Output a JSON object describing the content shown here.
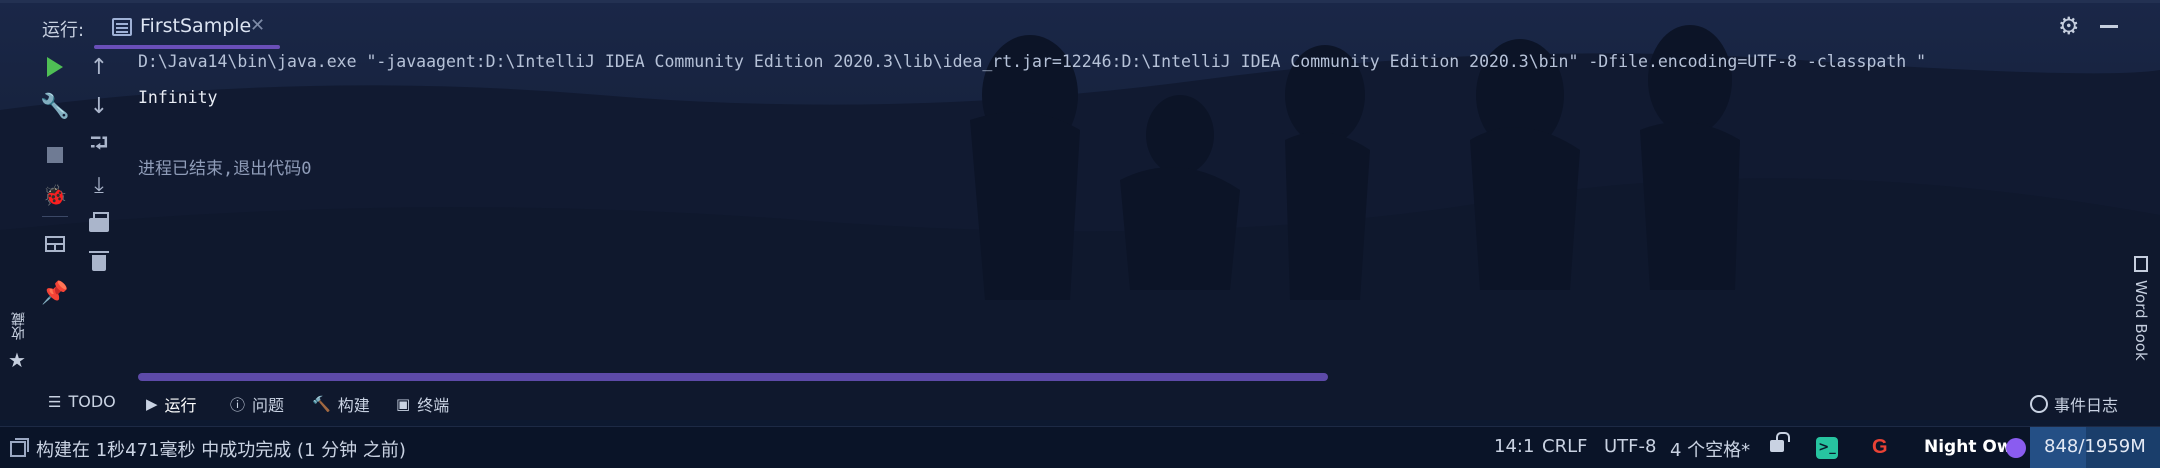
{
  "header": {
    "run_label": "运行:",
    "tab_title": "FirstSample"
  },
  "console": {
    "command_line": "D:\\Java14\\bin\\java.exe \"-javaagent:D:\\IntelliJ IDEA Community Edition 2020.3\\lib\\idea_rt.jar=12246:D:\\IntelliJ IDEA Community Edition 2020.3\\bin\" -Dfile.encoding=UTF-8 -classpath \"",
    "output": "Infinity",
    "exit_message": "进程已结束,退出代码0"
  },
  "left_toolbar": {
    "icons": [
      "run-icon",
      "wrench-icon",
      "stop-icon",
      "debug-icon",
      "layout-icon",
      "pin-icon"
    ]
  },
  "side_toolbar": {
    "icons": [
      "arrow-up-icon",
      "arrow-down-icon",
      "soft-wrap-icon",
      "scroll-to-end-icon",
      "print-icon",
      "trash-icon"
    ]
  },
  "favorites": {
    "label": "收藏"
  },
  "word_book": {
    "label": "Word Book"
  },
  "tool_windows": {
    "todo": "TODO",
    "run": "运行",
    "problems": "问题",
    "build": "构建",
    "terminal": "终端",
    "event_log": "事件日志"
  },
  "status_bar": {
    "message": "构建在 1秒471毫秒 中成功完成 (1 分钟 之前)",
    "position": "14:1",
    "line_separator": "CRLF",
    "encoding": "UTF-8",
    "indent": "4 个空格*",
    "theme": "Night Owl",
    "memory": "848/1959M",
    "memory_used_fraction": 0.43
  },
  "colors": {
    "run_green": "#4fbf55",
    "accent_purple": "#6a4fb8",
    "theme_dot": "#8a5cf0",
    "memory_bg": "#1a3e6b"
  }
}
